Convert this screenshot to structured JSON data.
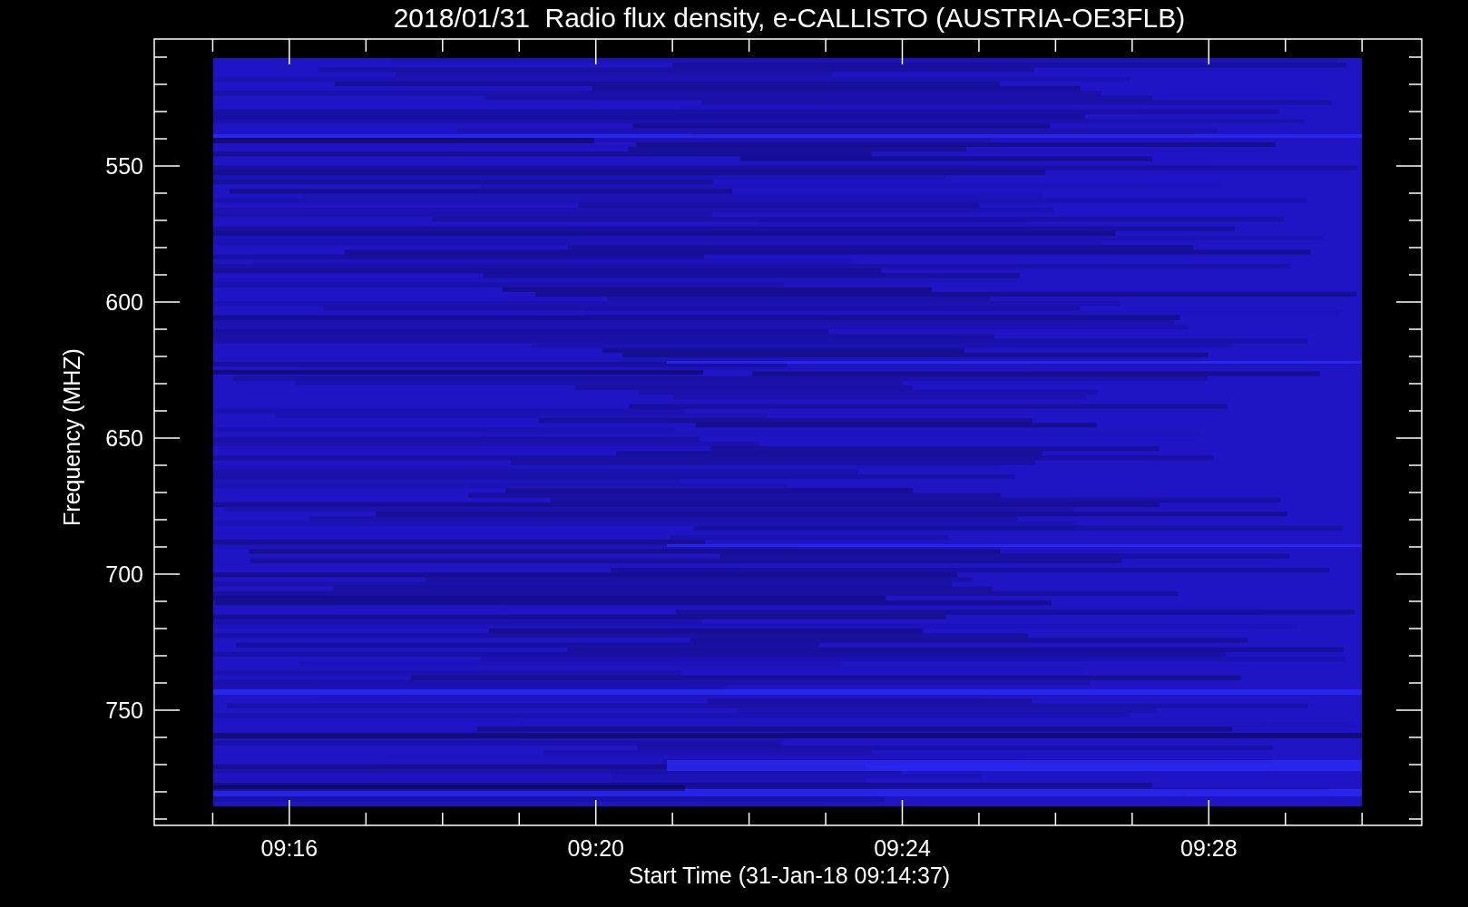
{
  "title": "2018/01/31  Radio flux density, e-CALLISTO (AUSTRIA-OE3FLB)",
  "y_axis": {
    "label": "Frequency (MHZ)",
    "ticks": [
      "550",
      "600",
      "650",
      "700",
      "750"
    ]
  },
  "x_axis": {
    "label": "Start Time (31-Jan-18 09:14:37)",
    "ticks": [
      "09:16",
      "09:20",
      "09:24",
      "09:28"
    ]
  }
}
